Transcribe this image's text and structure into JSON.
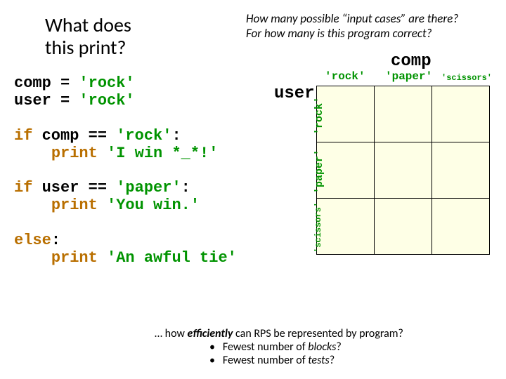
{
  "title": {
    "line1": "What does",
    "line2": "this print?"
  },
  "question": {
    "line1": "How many possible “input cases” are there?",
    "line2": "For how many is this program correct?"
  },
  "labels": {
    "comp": "comp",
    "user": "user"
  },
  "code": {
    "block1": {
      "l1_var": "comp",
      "l1_op": " = ",
      "l1_str": "'rock'",
      "l2_var": "user",
      "l2_op": " = ",
      "l2_str": "'rock'"
    },
    "block2": {
      "l1_kw": "if",
      "l1_rest_a": " comp ",
      "l1_op": "==",
      "l1_rest_b": " ",
      "l1_str": "'rock'",
      "l1_colon": ":",
      "l2_indent": "    ",
      "l2_kw": "print",
      "l2_sp": " ",
      "l2_str": "'I win *_*!'"
    },
    "block3": {
      "l1_kw": "if",
      "l1_rest_a": " user ",
      "l1_op": "==",
      "l1_rest_b": " ",
      "l1_str": "'paper'",
      "l1_colon": ":",
      "l2_indent": "    ",
      "l2_kw": "print",
      "l2_sp": " ",
      "l2_str": "'You win.'"
    },
    "block4": {
      "l1_kw": "else",
      "l1_colon": ":",
      "l2_indent": "    ",
      "l2_kw": "print",
      "l2_sp": " ",
      "l2_str": "'An awful tie'"
    }
  },
  "grid": {
    "cols": [
      "'rock'",
      "'paper'",
      "'scissors'"
    ],
    "rows": [
      "'rock'",
      "'paper'",
      "'scissors'"
    ]
  },
  "footer": {
    "lead": "… how ",
    "emph": "efficiently",
    "rest": " can RPS be represented by program?",
    "b1_lead": "Fewest number of ",
    "b1_em": "blocks",
    "b1_tail": "?",
    "b2_lead": "Fewest number of ",
    "b2_em": "tests",
    "b2_tail": "?",
    "bullet": "•"
  }
}
